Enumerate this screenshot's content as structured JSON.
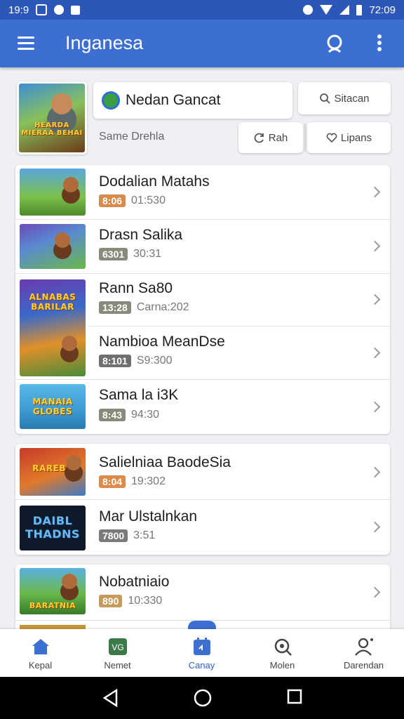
{
  "status_bar": {
    "time_left": "19:9",
    "time_right": "72:09"
  },
  "app_bar": {
    "title": "Inganesa"
  },
  "featured": {
    "name": "Nedan Gancat",
    "subtitle": "Same Drehla",
    "thumb_art": "HEARDA MIERAA BEHAI",
    "chips": [
      {
        "label": "Sitacan",
        "icon": "search-icon"
      },
      {
        "label": "Rah",
        "icon": "refresh-icon"
      },
      {
        "label": "Lipans",
        "icon": "heart-icon"
      }
    ]
  },
  "list_a": [
    {
      "title": "Dodalian Matahs",
      "badge": "8:06",
      "badge_color": "#d98a4a",
      "meta": "01:530",
      "art": ""
    },
    {
      "title": "Drasn Salika",
      "badge": "6301",
      "badge_color": "#8a8a7a",
      "meta": "30:31",
      "art": ""
    },
    {
      "title": "Rann Sa80",
      "badge": "13:28",
      "badge_color": "#8a8a7a",
      "meta": "Carna:202",
      "art": "ALNABAS BARILAR"
    },
    {
      "title": "Nambioa MeanDse",
      "badge": "8:101",
      "badge_color": "#6f6f6f",
      "meta": "S9:300",
      "art": ""
    },
    {
      "title": "Sama la i3K",
      "badge": "8:43",
      "badge_color": "#8a8a7a",
      "meta": "94:30",
      "art": "MANAIA GLOBES"
    }
  ],
  "list_b": [
    {
      "title": "Salielniaa BaodeSia",
      "badge": "8:04",
      "badge_color": "#e08a4a",
      "meta": "19:302",
      "art": "RAREBA"
    },
    {
      "title": "Mar Ulstalnkan",
      "badge": "7800",
      "badge_color": "#7a7a7a",
      "meta": "3:51",
      "art": "DAIBL THADNS"
    }
  ],
  "list_c": [
    {
      "title": "Nobatniaio",
      "badge": "890",
      "badge_color": "#c69a5a",
      "meta": "10:330",
      "art": "BARATNIA"
    }
  ],
  "bottom_nav": [
    {
      "label": "Kepal",
      "icon": "home-icon"
    },
    {
      "label": "Nemet",
      "icon": "vg-icon"
    },
    {
      "label": "Canay",
      "icon": "calendar-icon",
      "active": true
    },
    {
      "label": "Molen",
      "icon": "search-icon"
    },
    {
      "label": "Darendan",
      "icon": "person-icon"
    }
  ],
  "colors": {
    "primary": "#3d6fd3",
    "status": "#2c57b8",
    "active": "#2c63c9"
  }
}
